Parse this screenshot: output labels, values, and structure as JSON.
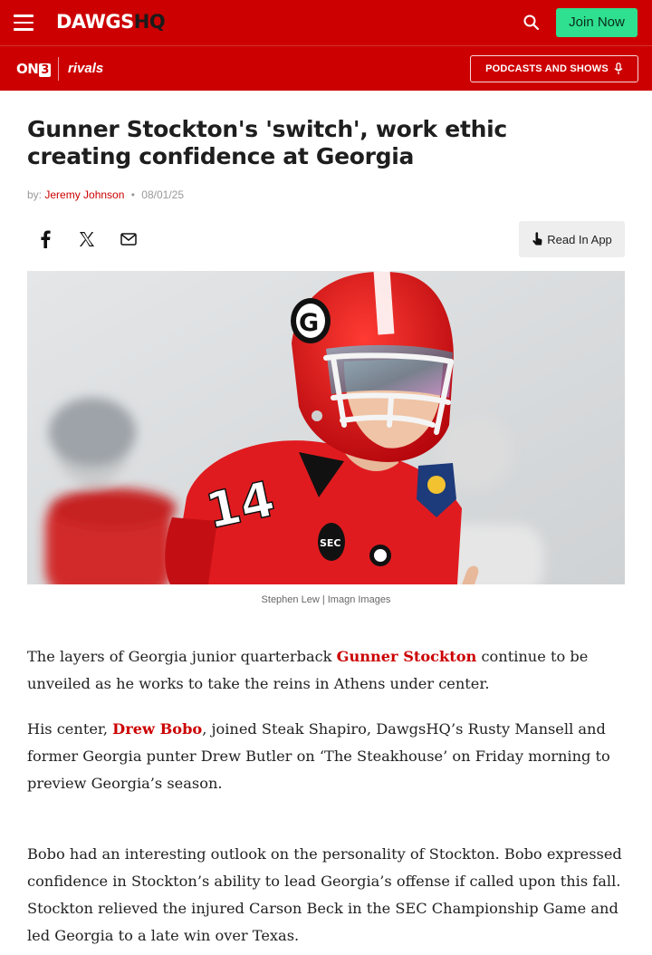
{
  "header": {
    "logo_main": "DAWGS",
    "logo_hq": "HQ",
    "join_label": "Join Now",
    "colors": {
      "brand_red": "#cc0000",
      "join_green": "#2ee08f"
    }
  },
  "subheader": {
    "on3_text": "ON",
    "on3_num": "3",
    "rivals_text": "rivals",
    "podcasts_label": "PODCASTS AND SHOWS"
  },
  "article": {
    "title": "Gunner Stockton's 'switch', work ethic creating confidence at Georgia",
    "by_prefix": "by:",
    "author": "Jeremy Johnson",
    "date": "08/01/25",
    "read_in_app": "Read In App",
    "photo_caption": "Stephen Lew | Imagn Images",
    "p1": {
      "before": "The layers of Georgia junior quarterback ",
      "link": "Gunner Stockton",
      "after": " continue to be unveiled as he works to take the reins in Athens under center."
    },
    "p2": {
      "before": "His center, ",
      "link": "Drew Bobo",
      "after": ", joined Steak Shapiro, DawgsHQ’s Rusty Mansell and former Georgia punter Drew Butler on ‘The Steakhouse’ on Friday morning to preview Georgia’s season."
    },
    "p3": "Bobo had an interesting outlook on the personality of Stockton. Bobo expressed confidence in Stockton’s ability to lead Georgia’s offense if called upon this fall. Stockton relieved the injured Carson Beck in the SEC Championship Game and led Georgia to a late win over Texas."
  },
  "hero_image": {
    "jersey_number": "14",
    "helmet_logo": "G",
    "sleeve_logo": "SEC"
  },
  "icons": [
    "menu-icon",
    "search-icon",
    "microphone-icon",
    "facebook-icon",
    "x-icon",
    "email-icon",
    "tap-icon"
  ]
}
